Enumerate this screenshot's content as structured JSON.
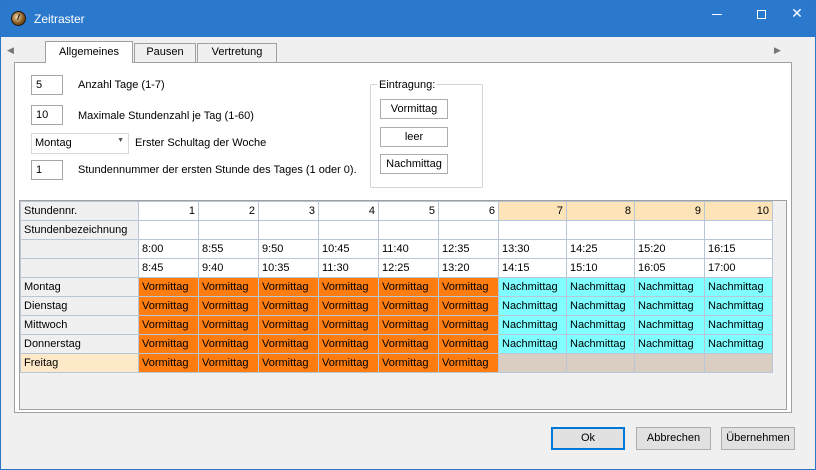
{
  "window": {
    "title": "Zeitraster"
  },
  "tabs": [
    {
      "label": "Allgemeines"
    },
    {
      "label": "Pausen"
    },
    {
      "label": "Vertretung"
    }
  ],
  "fields": {
    "days_value": "5",
    "days_label": "Anzahl Tage (1-7)",
    "max_hours_value": "10",
    "max_hours_label": "Maximale Stundenzahl je Tag (1-60)",
    "first_day_value": "Montag",
    "first_day_label": "Erster Schultag der Woche",
    "first_hour_value": "1",
    "first_hour_label": "Stundennummer der ersten Stunde des Tages (1 oder 0)."
  },
  "eintragung": {
    "title": "Eintragung:",
    "buttons": [
      "Vormittag",
      "leer",
      "Nachmittag"
    ]
  },
  "grid": {
    "header_label": "Stundennr.",
    "label_row": "Stundenbezeichnung",
    "numbers": [
      "1",
      "2",
      "3",
      "4",
      "5",
      "6",
      "7",
      "8",
      "9",
      "10"
    ],
    "start_times": [
      "8:00",
      "8:55",
      "9:50",
      "10:45",
      "11:40",
      "12:35",
      "13:30",
      "14:25",
      "15:20",
      "16:15"
    ],
    "end_times": [
      "8:45",
      "9:40",
      "10:35",
      "11:30",
      "12:25",
      "13:20",
      "14:15",
      "15:10",
      "16:05",
      "17:00"
    ],
    "days": [
      {
        "name": "Montag",
        "cells": [
          "Vormittag",
          "Vormittag",
          "Vormittag",
          "Vormittag",
          "Vormittag",
          "Vormittag",
          "Nachmittag",
          "Nachmittag",
          "Nachmittag",
          "Nachmittag"
        ]
      },
      {
        "name": "Dienstag",
        "cells": [
          "Vormittag",
          "Vormittag",
          "Vormittag",
          "Vormittag",
          "Vormittag",
          "Vormittag",
          "Nachmittag",
          "Nachmittag",
          "Nachmittag",
          "Nachmittag"
        ]
      },
      {
        "name": "Mittwoch",
        "cells": [
          "Vormittag",
          "Vormittag",
          "Vormittag",
          "Vormittag",
          "Vormittag",
          "Vormittag",
          "Nachmittag",
          "Nachmittag",
          "Nachmittag",
          "Nachmittag"
        ]
      },
      {
        "name": "Donnerstag",
        "cells": [
          "Vormittag",
          "Vormittag",
          "Vormittag",
          "Vormittag",
          "Vormittag",
          "Vormittag",
          "Nachmittag",
          "Nachmittag",
          "Nachmittag",
          "Nachmittag"
        ]
      },
      {
        "name": "Freitag",
        "cells": [
          "Vormittag",
          "Vormittag",
          "Vormittag",
          "Vormittag",
          "Vormittag",
          "Vormittag",
          "",
          "",
          "",
          ""
        ]
      }
    ]
  },
  "buttons": {
    "ok": "Ok",
    "cancel": "Abbrechen",
    "apply": "Übernehmen"
  },
  "colors": {
    "vormittag": "#ff7d10",
    "nachmittag": "#7fffff",
    "empty": "#d9cec1",
    "titlebar": "#2b79cd"
  }
}
